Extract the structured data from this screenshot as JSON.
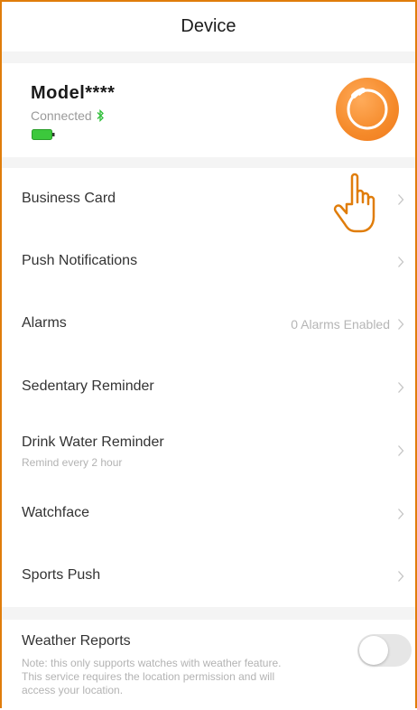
{
  "header": {
    "title": "Device"
  },
  "device": {
    "model": "Model****",
    "status": "Connected",
    "bluetooth_icon": "bluetooth-icon",
    "battery_icon": "battery-icon",
    "battery_color": "#3cc83c",
    "avatar_color": "#f58a2a"
  },
  "menu": {
    "business_card": "Business Card",
    "push_notifications": "Push Notifications",
    "alarms": "Alarms",
    "alarms_value": "0 Alarms Enabled",
    "sedentary": "Sedentary Reminder",
    "drink_water": "Drink Water Reminder",
    "drink_water_sub": "Remind every 2 hour",
    "watchface": "Watchface",
    "sports_push": "Sports Push"
  },
  "weather": {
    "label": "Weather Reports",
    "note_line1": "Note: this only supports watches with weather feature.",
    "note_line2": "This service requires the location permission and will",
    "note_line3": "access your location.",
    "enabled": false
  },
  "accent_color": "#e07d0b"
}
